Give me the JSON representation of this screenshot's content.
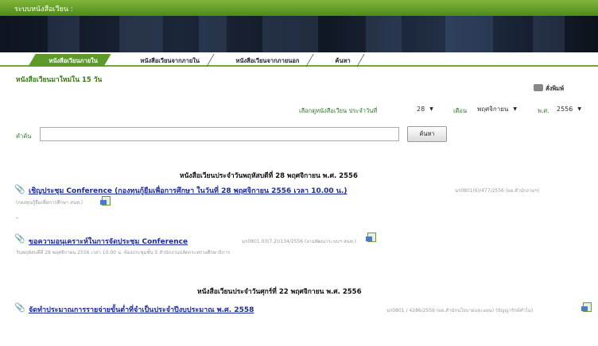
{
  "titlebar": {
    "text": "ระบบหนังสือเวียน :"
  },
  "tabs": [
    {
      "label": "หนังสือเวียนภายใน",
      "active": true
    },
    {
      "label": "หนังสือเวียนจากภายใน",
      "active": false
    },
    {
      "label": "หนังสือเวียนจากภายนอก",
      "active": false
    },
    {
      "label": "ค้นหา",
      "active": false
    }
  ],
  "page_title": "หนังสือเวียนมาใหม่ใน 15 วัน",
  "print_label": "สั่งพิมพ์",
  "filters": {
    "prompt": "เลือกดูหนังสือเวียน ประจำวันที่",
    "day": "28",
    "month_label": "เดือน",
    "month": "พฤศจิกายน",
    "year_label": "พ.ศ.",
    "year": "2556"
  },
  "search": {
    "label": "คำค้น",
    "button": "ค้นหา",
    "value": ""
  },
  "groups": [
    {
      "heading": "หนังสือเวียนประจำวันพฤหัสบดีที่ 28 พฤศจิกายน พ.ศ. 2556",
      "items": [
        {
          "title": "เชิญประชุม Conference (กองทุนกู้ยืมเพื่อการศึกษา ในวันที่ 28 พฤศจิกายน 2556 เวลา 10.00 น.)",
          "meta": "นร0801(6)/477/2556 (ผอ.สำนักงานฯ)",
          "sub": "(กองทุนกู้ยืมเพื่อการศึกษา สนท.)",
          "trail": "-"
        },
        {
          "title": "ขอความอนุเคราะห์ในการจัดประชุม Conference",
          "meta": "นร0801.03(7.2)/134/2556 (งานพัฒนาระบบฯ สนท.)",
          "sub": "วันพฤหัสบดีที่ 28 พฤศจิกายน 2556 เวลา 10.00 น. ห้องประชุมชั้น 5 สำนักงานปลัดกระทรวงศึกษาธิการ",
          "trail": ""
        }
      ]
    },
    {
      "heading": "หนังสือเวียนประจำวันศุกร์ที่ 22 พฤศจิกายน พ.ศ. 2556",
      "items": [
        {
          "title": "จัดทำประมาณการรายจ่ายขั้นต่ำที่จำเป็นประจำปีงบประมาณ พ.ศ. 2558",
          "meta": "นร0801 / 4286/2556 (ผอ.สำนักนโยบายและแผน) (ปัญญารักษ์ทำไม)",
          "sub": "",
          "trail": ""
        }
      ]
    }
  ]
}
